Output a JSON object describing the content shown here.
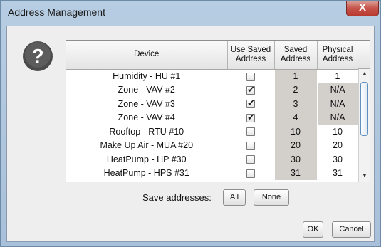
{
  "window": {
    "title": "Address Management",
    "close_label": "X"
  },
  "help": {
    "icon": "question-mark",
    "glyph": "?"
  },
  "table": {
    "headers": {
      "device": "Device",
      "use_saved": [
        "Use Saved",
        "Address"
      ],
      "saved": [
        "Saved",
        "Address"
      ],
      "physical": [
        "Physical",
        "Address"
      ]
    },
    "rows": [
      {
        "device": "Humidity - HU #1",
        "use_saved": false,
        "saved": "1",
        "physical": "1"
      },
      {
        "device": "Zone - VAV #2",
        "use_saved": true,
        "saved": "2",
        "physical": "N/A"
      },
      {
        "device": "Zone - VAV #3",
        "use_saved": true,
        "saved": "3",
        "physical": "N/A"
      },
      {
        "device": "Zone - VAV #4",
        "use_saved": true,
        "saved": "4",
        "physical": "N/A"
      },
      {
        "device": "Rooftop - RTU #10",
        "use_saved": false,
        "saved": "10",
        "physical": "10"
      },
      {
        "device": "Make Up Air - MUA #20",
        "use_saved": false,
        "saved": "20",
        "physical": "20"
      },
      {
        "device": "HeatPump - HP #30",
        "use_saved": false,
        "saved": "30",
        "physical": "30"
      },
      {
        "device": "HeatPump - HPS #31",
        "use_saved": false,
        "saved": "31",
        "physical": "31"
      }
    ]
  },
  "save_addresses": {
    "label": "Save addresses:",
    "all_label": "All",
    "none_label": "None"
  },
  "footer": {
    "ok_label": "OK",
    "cancel_label": "Cancel"
  },
  "colors": {
    "title_bar": "#b7cde2",
    "close_button": "#c7544a",
    "saved_cell_bg": "#d3d0cc",
    "help_icon": "#4a4a4a"
  }
}
